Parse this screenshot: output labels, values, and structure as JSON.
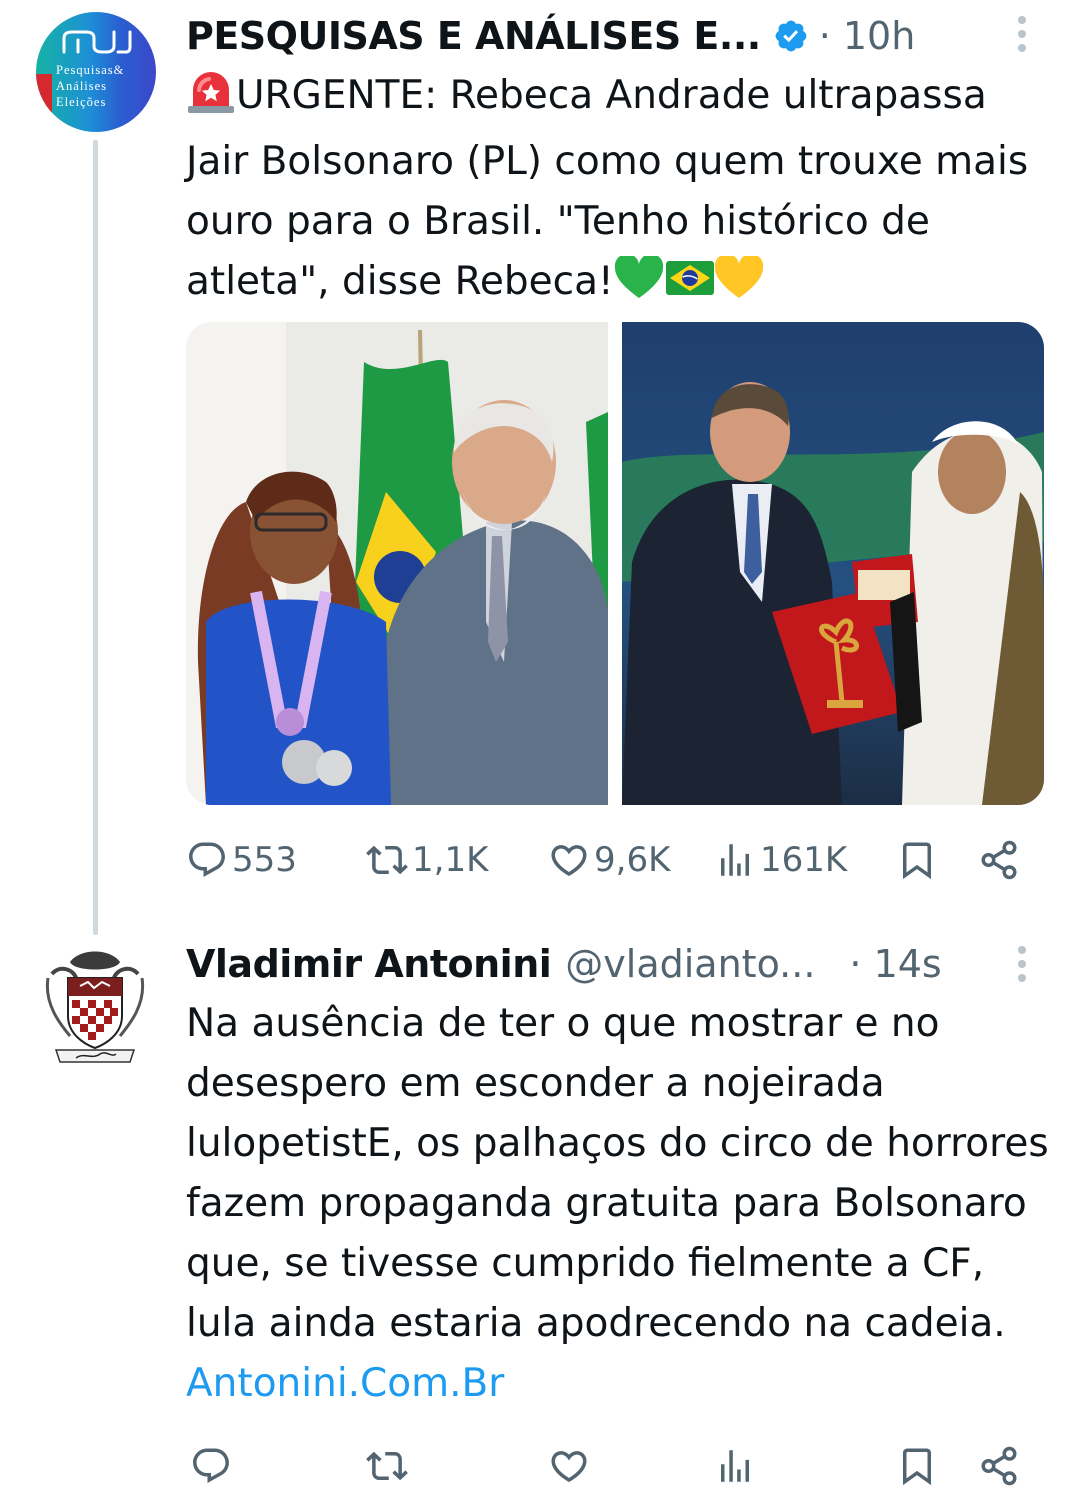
{
  "tweet1": {
    "author_name": "PESQUISAS E ANÁLISES E...",
    "timestamp": "· 10h",
    "avatar_text": [
      "Pesquisas&",
      "Análises",
      "Eleições"
    ],
    "emoji_prefix": "🚨",
    "text": "URGENTE: Rebeca Andrade ultrapassa Jair Bolsonaro (PL) como quem trouxe mais ouro para o Brasil. \"Tenho histórico de atleta\", disse Rebeca!",
    "emoji_suffix": "💚🇧🇷💛",
    "media": [
      {
        "icon": "photo-rebeca-lula"
      },
      {
        "icon": "photo-bolsonaro-award"
      }
    ],
    "actions": {
      "replies": "553",
      "reposts": "1,1K",
      "likes": "9,6K",
      "views": "161K"
    }
  },
  "tweet2": {
    "author_name": "Vladimir Antonini",
    "handle": "@vladianto...",
    "timestamp": "· 14s",
    "text": "Na ausência de ter o que mostrar e no desespero em esconder a nojeirada lulopetistE, os palhaços do circo de horrores fazem propaganda gratuita para Bolsonaro que, se tivesse cumprido fielmente a CF, lula ainda estaria apodrecendo na cadeia.",
    "link": "Antonini.Com.Br"
  },
  "colors": {
    "text": "#0f1419",
    "secondary": "#536471",
    "link": "#1d9bf0",
    "verified": "#1d9bf0",
    "thread_line": "#cfd9de"
  }
}
